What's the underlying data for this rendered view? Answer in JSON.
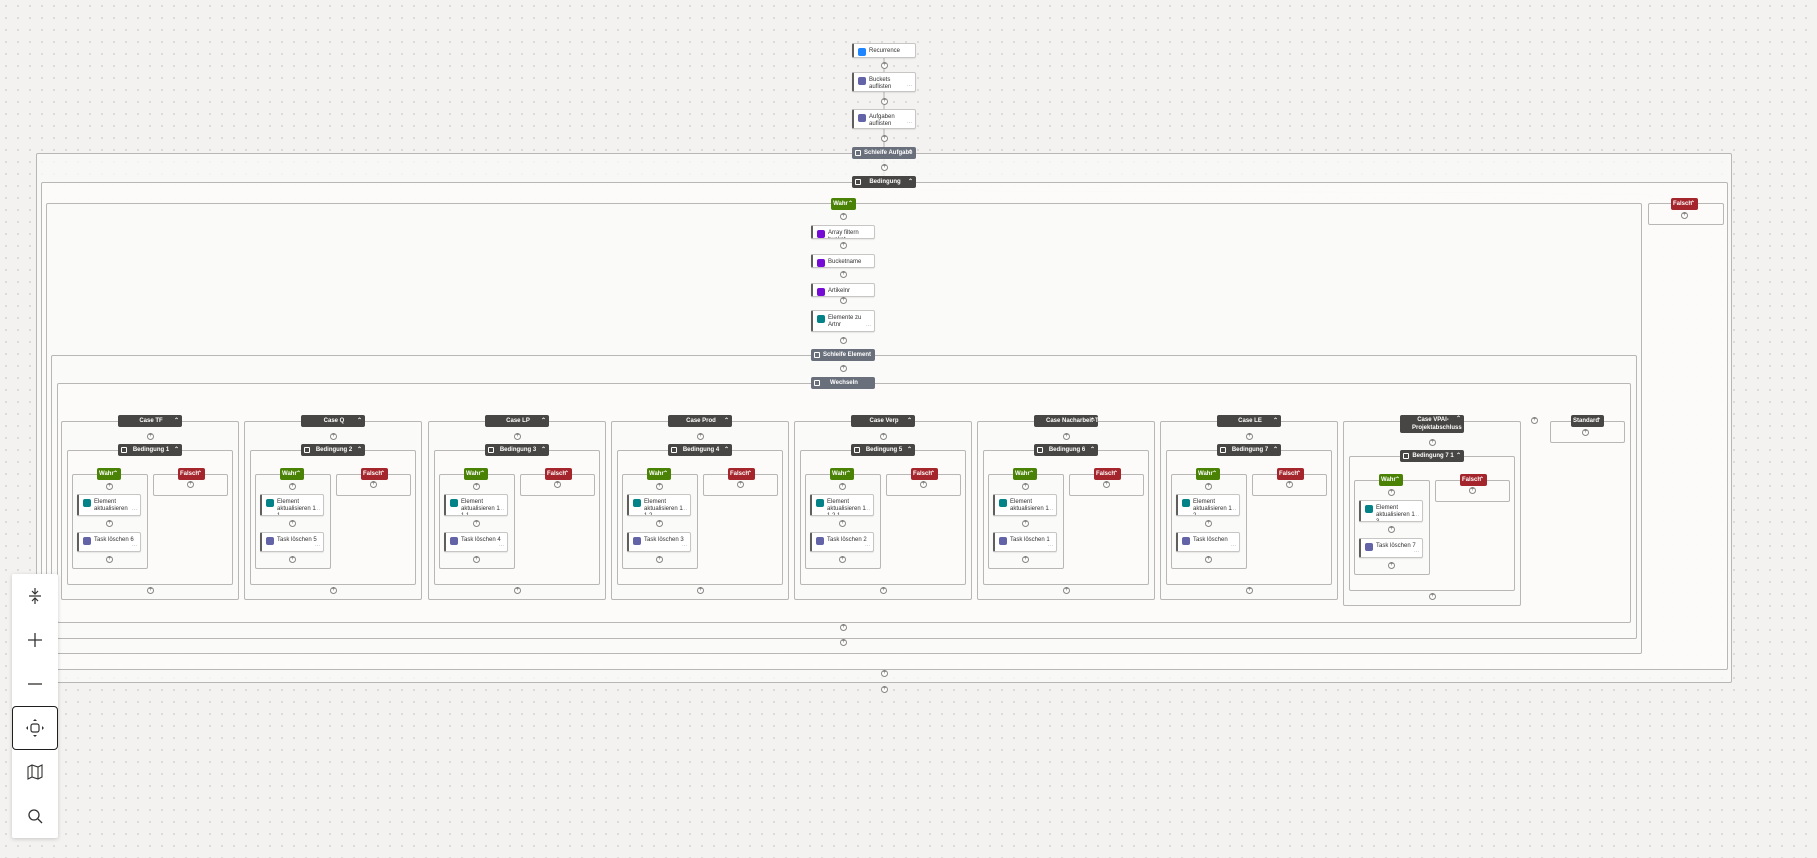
{
  "colors": {
    "dark": "#484644",
    "grey": "#69707c",
    "green": "#498205",
    "red": "#a4262c",
    "teams": "#6264a7",
    "sharepoint": "#038387",
    "recurrence": "#1f85ff",
    "variable": "#770bd6"
  },
  "top_actions": [
    {
      "label": "Recurrence",
      "icon": "recurrence-icon",
      "color": "#1f85ff"
    },
    {
      "label": "Buckets auflisten",
      "icon": "planner-icon",
      "color": "#6264a7"
    },
    {
      "label": "Aufgaben auflisten",
      "icon": "planner-icon",
      "color": "#6264a7"
    }
  ],
  "loop1": {
    "label": "Schleife Aufgabe"
  },
  "cond_main": {
    "label": "Bedingung",
    "true_label": "Wahr",
    "false_label": "Falsch"
  },
  "inner_actions": [
    {
      "label": "Array filtern bucket",
      "icon": "data-operation-icon",
      "color": "#770bd6"
    },
    {
      "label": "Bucketname",
      "icon": "data-operation-icon",
      "color": "#770bd6"
    },
    {
      "label": "Artikelnr",
      "icon": "data-operation-icon",
      "color": "#770bd6"
    },
    {
      "label": "Elemente zu Artnr",
      "icon": "sharepoint-icon",
      "color": "#038387"
    }
  ],
  "loop2": {
    "label": "Schleife Element"
  },
  "switch": {
    "label": "Wechseln"
  },
  "cases": [
    {
      "label": "Case TF",
      "cond": "Bedingung 1",
      "update": "Element aktualisieren",
      "task": "Task löschen 6"
    },
    {
      "label": "Case Q",
      "cond": "Bedingung 2",
      "update": "Element aktualisieren 1 1",
      "task": "Task löschen 5"
    },
    {
      "label": "Case LP",
      "cond": "Bedingung 3",
      "update": "Element aktualisieren 1 1 1",
      "task": "Task löschen 4"
    },
    {
      "label": "Case Prod",
      "cond": "Bedingung 4",
      "update": "Element aktualisieren 1 1 2",
      "task": "Task löschen 3"
    },
    {
      "label": "Case Verp",
      "cond": "Bedingung 5",
      "update": "Element aktualisieren 1 1 2 1",
      "task": "Task löschen 2"
    },
    {
      "label": "Case Nacharbeit-TK",
      "cond": "Bedingung 6",
      "update": "Element aktualisieren 1",
      "task": "Task löschen 1"
    },
    {
      "label": "Case LE",
      "cond": "Bedingung 7",
      "update": "Element aktualisieren 1 2",
      "task": "Task löschen"
    },
    {
      "label": "Case VPAI-Projektabschluss",
      "cond": "Bedingung 7 1",
      "update": "Element aktualisieren 1 3",
      "task": "Task löschen 7"
    }
  ],
  "default_case": {
    "label": "Standard"
  },
  "branch": {
    "true_label": "Wahr",
    "false_label": "Falsch"
  },
  "dots": "···",
  "plus": "+",
  "toolbar": [
    {
      "name": "fit-height-button",
      "icon": "fit-height-icon"
    },
    {
      "name": "zoom-in-button",
      "icon": "zoom-in-icon"
    },
    {
      "name": "zoom-out-button",
      "icon": "zoom-out-icon"
    },
    {
      "name": "fit-view-button",
      "icon": "fit-view-icon"
    },
    {
      "name": "minimap-button",
      "icon": "map-icon"
    },
    {
      "name": "search-button",
      "icon": "search-icon"
    }
  ]
}
